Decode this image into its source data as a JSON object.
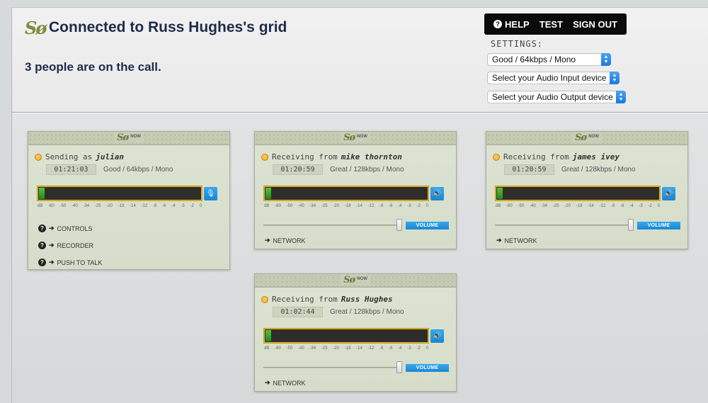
{
  "header": {
    "logo_text": "Sø",
    "title": "Connected to Russ Hughes's grid",
    "subtitle": "3 people are on the call."
  },
  "nav": {
    "help": "HELP",
    "test": "TEST",
    "signout": "SIGN OUT"
  },
  "settings": {
    "label": "SETTINGS:",
    "quality": "Good / 64kbps / Mono",
    "audio_input": "Select your Audio Input device",
    "audio_output": "Select your Audio Output device"
  },
  "panel_logo": "Sø",
  "panel_logo_tag": "NOW",
  "scale": [
    "dB",
    "-60",
    "-50",
    "-40",
    "-34",
    "-25",
    "-20",
    "-18",
    "-14",
    "-12",
    "-8",
    "-6",
    "-4",
    "-3",
    "-2",
    "0"
  ],
  "panels": [
    {
      "status_prefix": "Sending as",
      "name": "julian",
      "time": "01:21:03",
      "quality": "Good / 64kbps / Mono",
      "links": [
        "CONTROLS",
        "RECORDER",
        "PUSH TO TALK"
      ]
    },
    {
      "status_prefix": "Receiving from",
      "name": "mike thornton",
      "time": "01:20:59",
      "quality": "Great / 128kbps / Mono",
      "volume_label": "VOLUME",
      "network_label": "NETWORK"
    },
    {
      "status_prefix": "Receiving from",
      "name": "james ivey",
      "time": "01:20:59",
      "quality": "Great / 128kbps / Mono",
      "volume_label": "VOLUME",
      "network_label": "NETWORK"
    },
    {
      "status_prefix": "Receiving from",
      "name": "Russ Hughes",
      "time": "01:02:44",
      "quality": "Great / 128kbps / Mono",
      "volume_label": "VOLUME",
      "network_label": "NETWORK"
    }
  ]
}
